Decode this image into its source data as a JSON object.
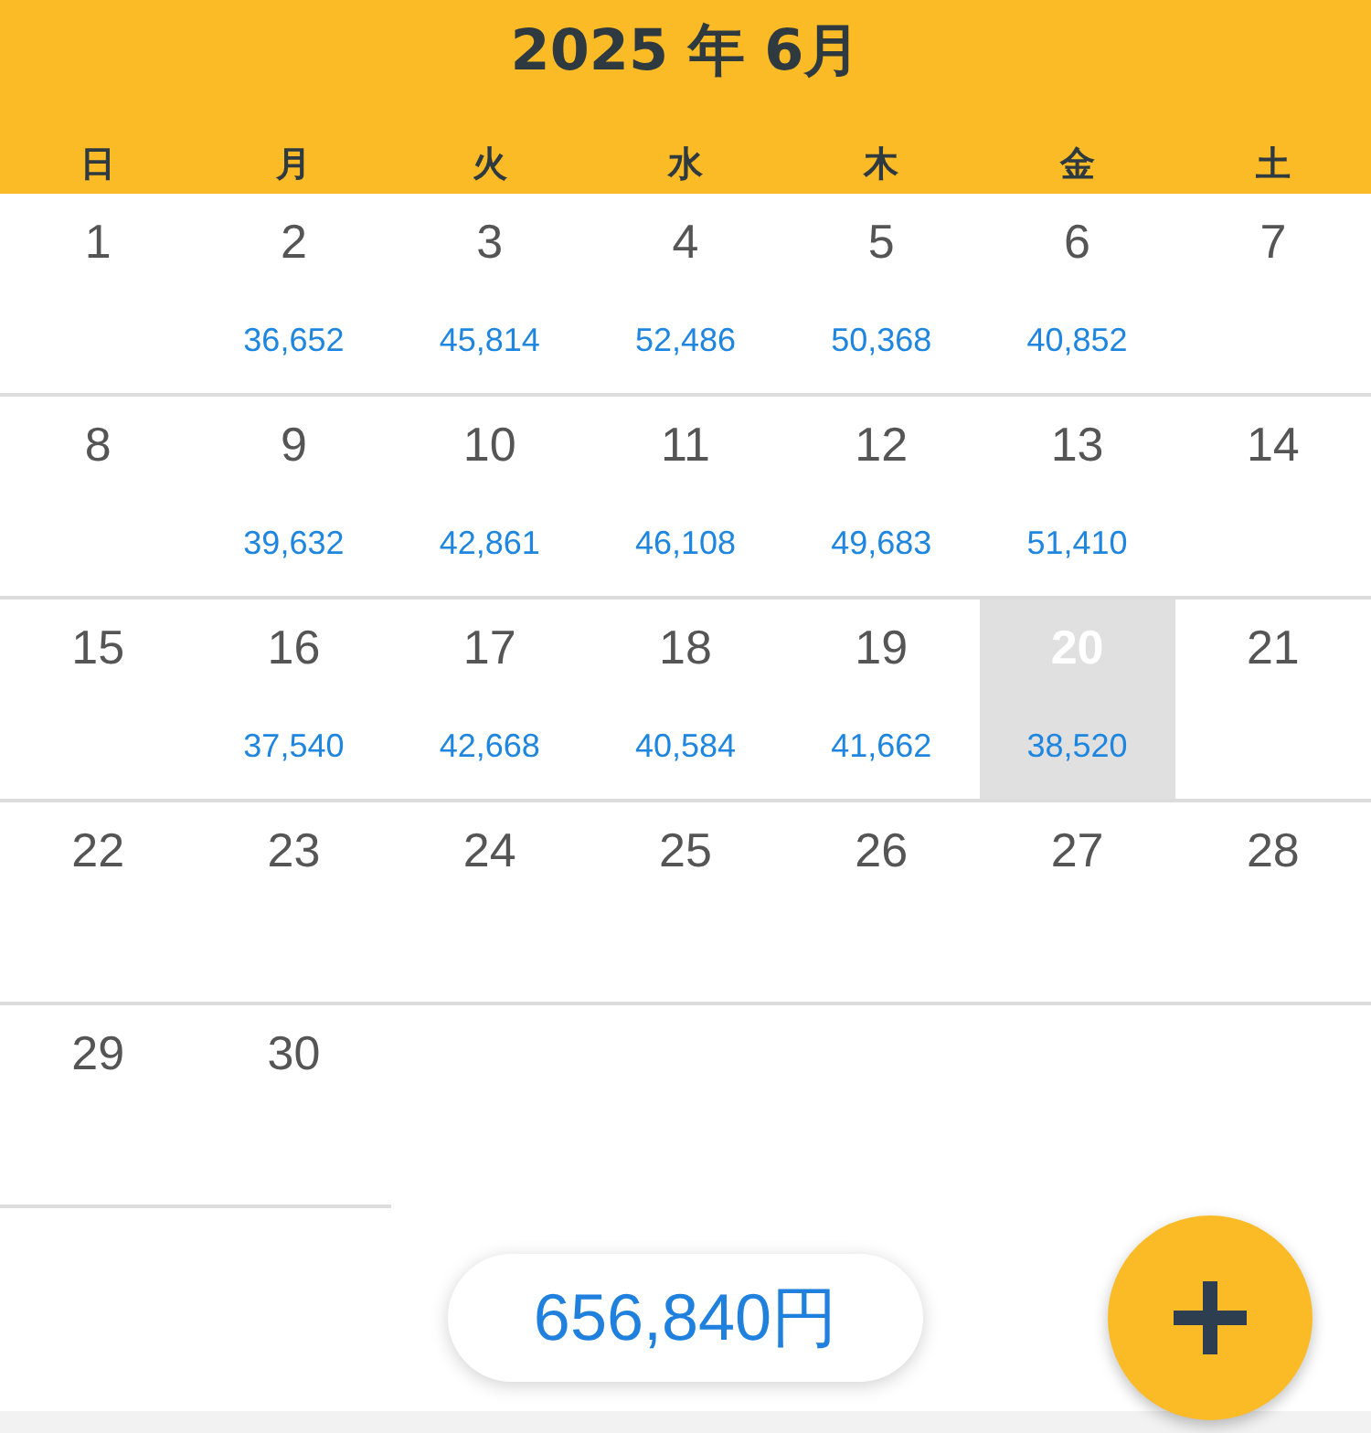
{
  "header": {
    "title": "2025 年 6月",
    "weekdays": [
      "日",
      "月",
      "火",
      "水",
      "木",
      "金",
      "土"
    ]
  },
  "weeks": [
    [
      {
        "day": "1",
        "selected": false
      },
      {
        "day": "2",
        "amount": "36,652",
        "selected": false
      },
      {
        "day": "3",
        "amount": "45,814",
        "selected": false
      },
      {
        "day": "4",
        "amount": "52,486",
        "selected": false
      },
      {
        "day": "5",
        "amount": "50,368",
        "selected": false
      },
      {
        "day": "6",
        "amount": "40,852",
        "selected": false
      },
      {
        "day": "7",
        "selected": false
      }
    ],
    [
      {
        "day": "8",
        "selected": false
      },
      {
        "day": "9",
        "amount": "39,632",
        "selected": false
      },
      {
        "day": "10",
        "amount": "42,861",
        "selected": false
      },
      {
        "day": "11",
        "amount": "46,108",
        "selected": false
      },
      {
        "day": "12",
        "amount": "49,683",
        "selected": false
      },
      {
        "day": "13",
        "amount": "51,410",
        "selected": false
      },
      {
        "day": "14",
        "selected": false
      }
    ],
    [
      {
        "day": "15",
        "selected": false
      },
      {
        "day": "16",
        "amount": "37,540",
        "selected": false
      },
      {
        "day": "17",
        "amount": "42,668",
        "selected": false
      },
      {
        "day": "18",
        "amount": "40,584",
        "selected": false
      },
      {
        "day": "19",
        "amount": "41,662",
        "selected": false
      },
      {
        "day": "20",
        "amount": "38,520",
        "selected": true
      },
      {
        "day": "21",
        "selected": false
      }
    ],
    [
      {
        "day": "22",
        "selected": false
      },
      {
        "day": "23",
        "selected": false
      },
      {
        "day": "24",
        "selected": false
      },
      {
        "day": "25",
        "selected": false
      },
      {
        "day": "26",
        "selected": false
      },
      {
        "day": "27",
        "selected": false
      },
      {
        "day": "28",
        "selected": false
      }
    ],
    [
      {
        "day": "29",
        "selected": false
      },
      {
        "day": "30",
        "selected": false
      }
    ]
  ],
  "total": "656,840円"
}
